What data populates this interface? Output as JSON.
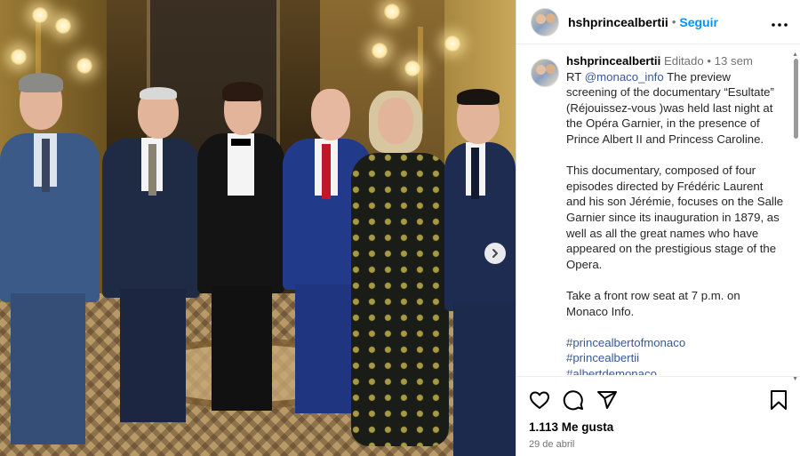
{
  "header": {
    "username": "hshprincealbertii",
    "separator": "•",
    "follow_label": "Seguir",
    "more_icon": "more-horizontal-icon"
  },
  "caption": {
    "username": "hshprincealbertii",
    "edited_label": "Editado",
    "separator": "•",
    "age": "13 sem",
    "rt_prefix": "RT",
    "mention": "@monaco_info",
    "paragraph1_rest": "The preview screening of the documentary “Esultate” (Réjouissez-vous )was held last night at the Opéra Garnier, in the presence of Prince Albert II and Princess Caroline.",
    "paragraph2": "This documentary, composed of four episodes directed by Frédéric Laurent and his son Jérémie, focuses on the Salle Garnier since its inauguration in 1879, as well as all the great names who have appeared on the prestigious stage of the Opera.",
    "paragraph3": "Take a front row seat at 7 p.m. on Monaco Info.",
    "hashtags": [
      "#princealbertofmonaco",
      "#princealbertii",
      "#albertdemonaco"
    ]
  },
  "actions": {
    "like_icon": "heart-icon",
    "comment_icon": "comment-icon",
    "share_icon": "send-icon",
    "save_icon": "bookmark-icon",
    "likes": "1.113 Me gusta",
    "date": "29 de abril"
  },
  "carousel": {
    "next_icon": "chevron-right-icon"
  },
  "colors": {
    "link": "#385898",
    "follow": "#0095f6",
    "meta": "#737373"
  }
}
